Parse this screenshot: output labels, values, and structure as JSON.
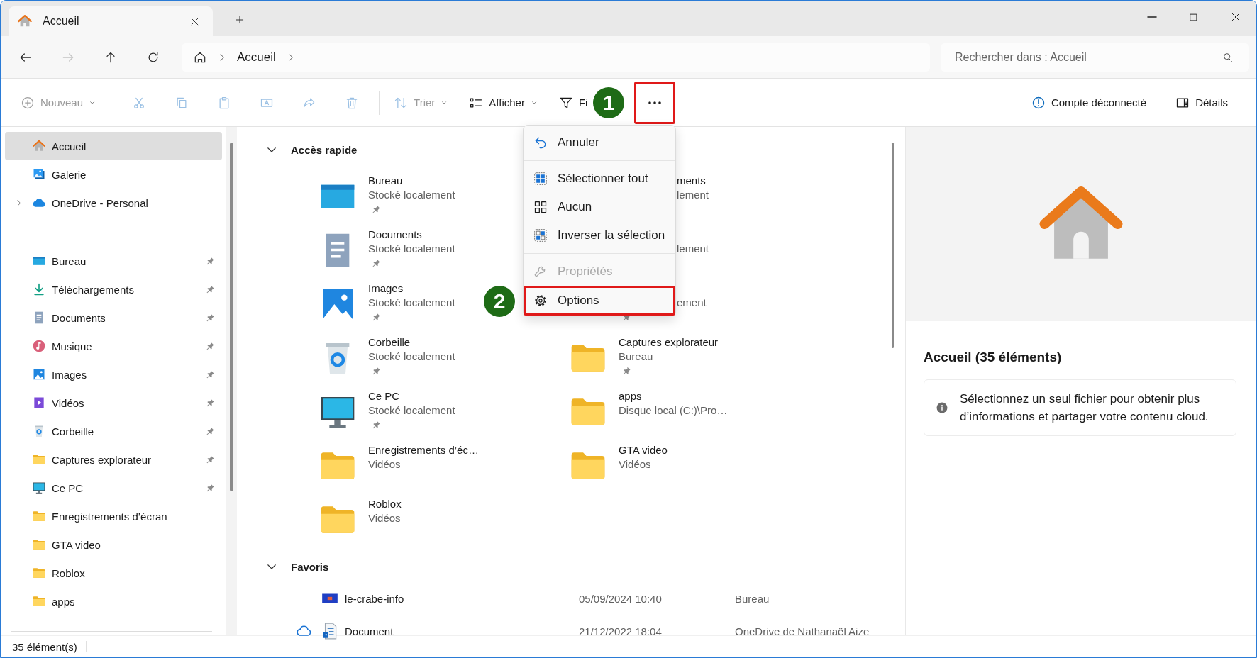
{
  "tab": {
    "title": "Accueil"
  },
  "nav": [
    {
      "kind": "back",
      "disabled": false
    },
    {
      "kind": "forward",
      "disabled": true
    },
    {
      "kind": "up",
      "disabled": false
    },
    {
      "kind": "refresh",
      "disabled": false
    }
  ],
  "address": {
    "crumbs": [
      "Accueil"
    ]
  },
  "search": {
    "placeholder": "Rechercher dans : Accueil"
  },
  "toolbar": {
    "items": [
      {
        "kind": "new",
        "label": "Nouveau",
        "disabled": true,
        "highlighted": false
      },
      {
        "kind": "separator"
      },
      {
        "kind": "cut",
        "disabled": true,
        "highlighted": false
      },
      {
        "kind": "copy",
        "disabled": true,
        "highlighted": false
      },
      {
        "kind": "paste",
        "disabled": true,
        "highlighted": false
      },
      {
        "kind": "rename",
        "disabled": true,
        "highlighted": false
      },
      {
        "kind": "share",
        "disabled": true,
        "highlighted": false
      },
      {
        "kind": "delete",
        "disabled": true,
        "highlighted": false
      },
      {
        "kind": "separator"
      },
      {
        "kind": "sort",
        "label": "Trier",
        "disabled": true,
        "highlighted": false
      },
      {
        "kind": "view",
        "label": "Afficher",
        "disabled": false,
        "highlighted": false
      },
      {
        "kind": "filter",
        "label": "Fi",
        "disabled": false,
        "highlighted": false
      },
      {
        "kind": "more",
        "disabled": false,
        "highlighted": true,
        "callout": "1"
      }
    ],
    "right": [
      {
        "kind": "account",
        "label": "Compte déconnecté"
      },
      {
        "kind": "details",
        "label": "Détails"
      }
    ]
  },
  "sidebar": {
    "top": [
      {
        "kind": "home",
        "label": "Accueil",
        "selected": true,
        "expandable": false
      },
      {
        "kind": "gallery",
        "label": "Galerie",
        "selected": false,
        "expandable": false
      },
      {
        "kind": "cloud",
        "label": "OneDrive - Personal",
        "selected": false,
        "expandable": true
      }
    ],
    "pinned": [
      {
        "kind": "desktop",
        "label": "Bureau",
        "selected": false,
        "pinned": true
      },
      {
        "kind": "download",
        "label": "Téléchargements",
        "selected": false,
        "pinned": true
      },
      {
        "kind": "documents",
        "label": "Documents",
        "selected": false,
        "pinned": true
      },
      {
        "kind": "music",
        "label": "Musique",
        "selected": false,
        "pinned": true
      },
      {
        "kind": "pictures",
        "label": "Images",
        "selected": false,
        "pinned": true
      },
      {
        "kind": "video",
        "label": "Vidéos",
        "selected": false,
        "pinned": true
      },
      {
        "kind": "trash",
        "label": "Corbeille",
        "selected": false,
        "pinned": true
      },
      {
        "kind": "folder",
        "label": "Captures explorateur",
        "selected": false,
        "pinned": true
      },
      {
        "kind": "pc",
        "label": "Ce PC",
        "selected": false,
        "pinned": true
      },
      {
        "kind": "folder",
        "label": "Enregistrements d’écran",
        "selected": false,
        "pinned": false
      },
      {
        "kind": "folder",
        "label": "GTA video",
        "selected": false,
        "pinned": false
      },
      {
        "kind": "folder",
        "label": "Roblox",
        "selected": false,
        "pinned": false
      },
      {
        "kind": "folder",
        "label": "apps",
        "selected": false,
        "pinned": false
      }
    ]
  },
  "quick_access": {
    "title": "Accès rapide",
    "expanded": true,
    "items": [
      {
        "kind": "desktop",
        "name": "Bureau",
        "sub": "Stocké localement",
        "pinned": true
      },
      {
        "kind": "partial",
        "name": "ments",
        "sub": "lement",
        "pinned": false
      },
      {
        "kind": "documents",
        "name": "Documents",
        "sub": "Stocké localement",
        "pinned": true
      },
      {
        "kind": "partial",
        "sub": "lement",
        "pinned": false
      },
      {
        "kind": "pictures",
        "name": "Images",
        "sub": "Stocké localement",
        "pinned": true
      },
      {
        "kind": "partial",
        "sub": "ement",
        "pinned": true
      },
      {
        "kind": "trash",
        "name": "Corbeille",
        "sub": "Stocké localement",
        "pinned": true
      },
      {
        "kind": "folder",
        "name": "Captures explorateur",
        "sub": "Bureau",
        "pinned": true
      },
      {
        "kind": "pc",
        "name": "Ce PC",
        "sub": "Stocké localement",
        "pinned": true
      },
      {
        "kind": "folder",
        "name": "apps",
        "sub": "Disque local (C:)\\Pro…",
        "pinned": false
      },
      {
        "kind": "folder",
        "name": "Enregistrements d’éc…",
        "sub": "Vidéos",
        "pinned": false
      },
      {
        "kind": "folder",
        "name": "GTA video",
        "sub": "Vidéos",
        "pinned": false
      },
      {
        "kind": "folder",
        "name": "Roblox",
        "sub": "Vidéos",
        "pinned": false
      }
    ]
  },
  "favorites": {
    "title": "Favoris",
    "expanded": true,
    "rows": [
      {
        "kind": "image",
        "name": "le-crabe-info",
        "date": "05/09/2024 10:40",
        "location": "Bureau",
        "cloud": false
      },
      {
        "kind": "shortcut",
        "name": "Document",
        "date": "21/12/2022 18:04",
        "location": "OneDrive de Nathanaël Aize",
        "cloud": true
      }
    ]
  },
  "details_pane": {
    "title": "Accueil (35 éléments)",
    "message": "Sélectionnez un seul fichier pour obtenir plus d’informations et partager votre contenu cloud."
  },
  "status_bar": {
    "count": "35 élément(s)"
  },
  "more_menu": {
    "items": [
      {
        "kind": "undo",
        "label": "Annuler",
        "disabled": false,
        "highlighted": false
      },
      {
        "kind": "separator"
      },
      {
        "kind": "select-all",
        "label": "Sélectionner tout",
        "disabled": false,
        "highlighted": false
      },
      {
        "kind": "select-none",
        "label": "Aucun",
        "disabled": false,
        "highlighted": false
      },
      {
        "kind": "invert",
        "label": "Inverser la sélection",
        "disabled": false,
        "highlighted": false
      },
      {
        "kind": "separator"
      },
      {
        "kind": "properties",
        "label": "Propriétés",
        "disabled": true,
        "highlighted": false
      },
      {
        "kind": "options",
        "label": "Options",
        "disabled": false,
        "highlighted": true,
        "callout": "2"
      }
    ]
  }
}
